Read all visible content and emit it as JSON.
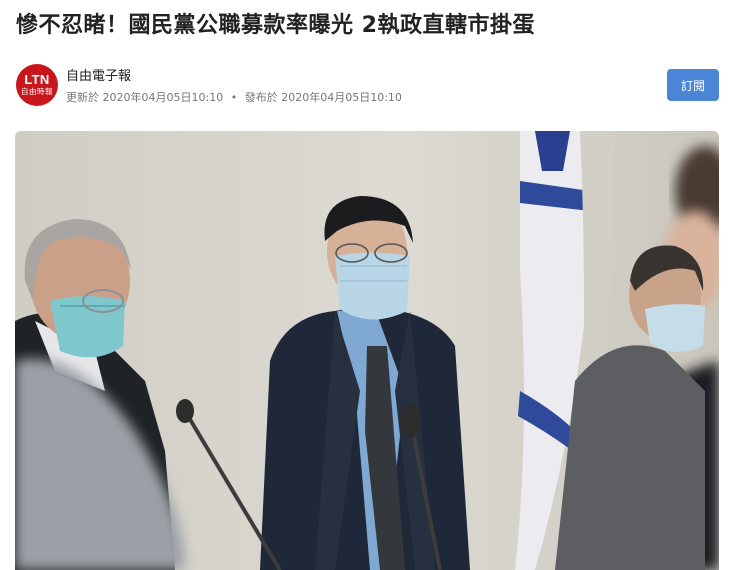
{
  "article": {
    "headline": "慘不忍睹！國民黨公職募款率曝光 2執政直轄市掛蛋",
    "photo_description_icon": "news-photo",
    "colors": {
      "subscribe_button": "#4a85d6",
      "logo_bg": "#c8161d"
    }
  },
  "publisher": {
    "logo_text": "LTN",
    "logo_subtext": "自由時報",
    "name": "自由電子報",
    "updated_label": "更新於",
    "updated_time": "2020年04月05日10:10",
    "separator": "•",
    "published_label": "發布於",
    "published_time": "2020年04月05日10:10"
  },
  "actions": {
    "subscribe_label": "訂閱"
  }
}
